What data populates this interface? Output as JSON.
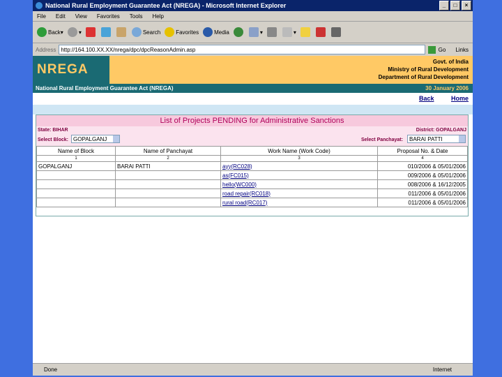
{
  "window": {
    "title": "National Rural Employment Guarantee Act (NREGA) - Microsoft Internet Explorer"
  },
  "menu": [
    "File",
    "Edit",
    "View",
    "Favorites",
    "Tools",
    "Help"
  ],
  "toolbar": {
    "back": "Back",
    "search": "Search",
    "favorites": "Favorites",
    "media": "Media"
  },
  "address": {
    "label": "Address",
    "url": "http://164.100.XX.XX/nrega/dpc/dpcReasonAdmin.asp",
    "go": "Go",
    "links": "Links"
  },
  "header": {
    "logo": "NREGA",
    "govt": [
      "Govt. of India",
      "Ministry of Rural Development",
      "Department of Rural Development"
    ],
    "act": "National Rural Employment Guarantee Act (NREGA)",
    "date": "30 January 2006",
    "back": "Back",
    "home": "Home"
  },
  "panel": {
    "title": "List of Projects PENDING for Administrative Sanctions",
    "state": "State: BIHAR",
    "district": "District: GOPALGANJ",
    "block_label": "Select Block:",
    "block_value": "GOPALGANJ",
    "panchayat_label": "Select Panchayat:",
    "panchayat_value": "BARAI PATTI"
  },
  "table": {
    "headers": [
      "Name of Block",
      "Name of Panchayat",
      "Work Name (Work Code)",
      "Proposal No. & Date"
    ],
    "numbers": [
      "1",
      "2",
      "3",
      "4"
    ],
    "rows": [
      {
        "block": "GOPALGANJ",
        "panchayat": "BARAI PATTI",
        "work": "ayy(RC028)",
        "proposal": "010/2006 & 05/01/2006"
      },
      {
        "block": "",
        "panchayat": "",
        "work": "as(FC015)",
        "proposal": "009/2006 & 05/01/2006"
      },
      {
        "block": "",
        "panchayat": "",
        "work": "hello(WC000)",
        "proposal": "008/2006 & 16/12/2005"
      },
      {
        "block": "",
        "panchayat": "",
        "work": "road repair(RC018)",
        "proposal": "011/2006 & 05/01/2006"
      },
      {
        "block": "",
        "panchayat": "",
        "work": "rural road(RC017)",
        "proposal": "011/2006 & 05/01/2006"
      }
    ]
  },
  "status": {
    "left": "Done",
    "right": "Internet"
  }
}
